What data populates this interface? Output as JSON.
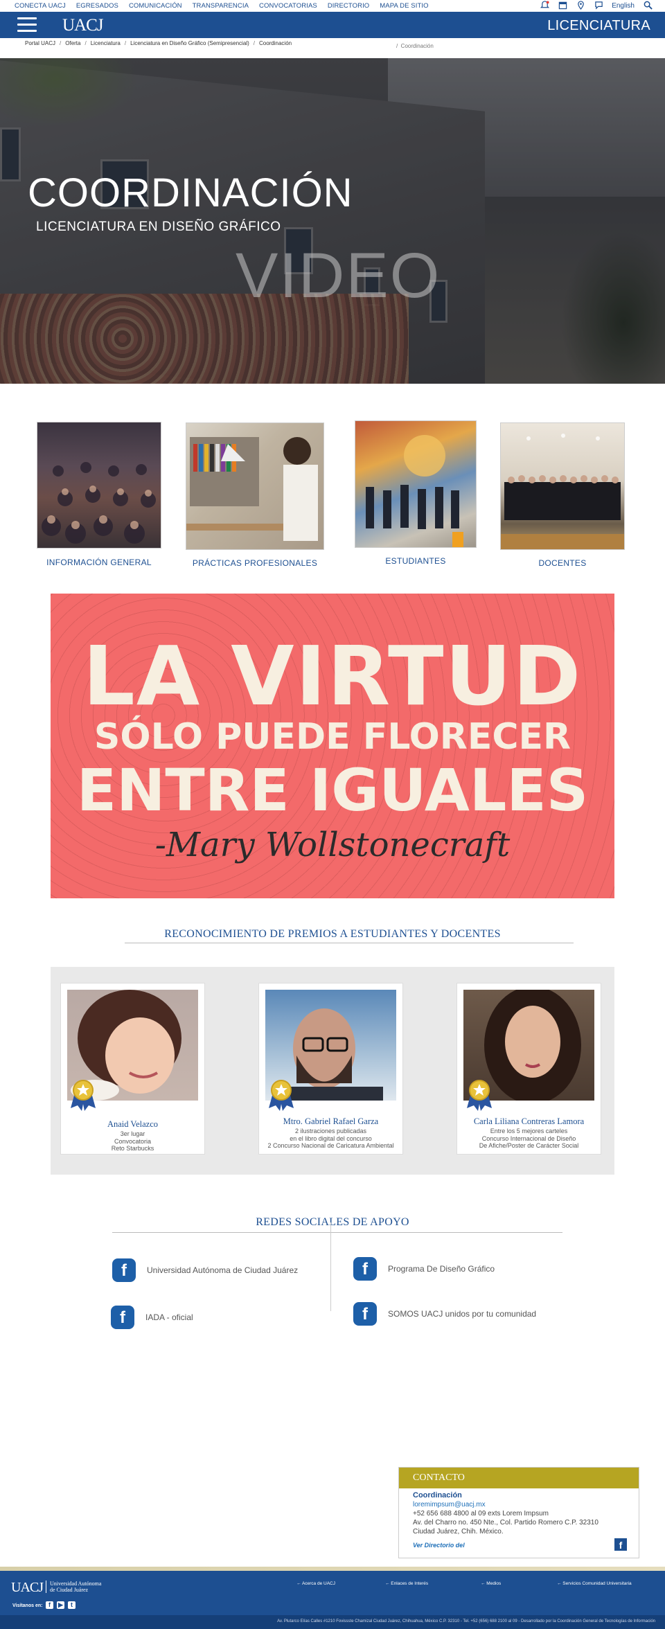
{
  "topbar": {
    "links": [
      "CONECTA UACJ",
      "EGRESADOS",
      "COMUNICACIÓN",
      "TRANSPARENCIA",
      "CONVOCATORIAS",
      "DIRECTORIO",
      "MAPA DE SITIO"
    ],
    "language": "English",
    "icons": [
      "notification-bell-icon",
      "calendar-icon",
      "map-pin-icon",
      "chat-icon",
      "search-icon"
    ]
  },
  "navbar": {
    "logo": "UACJ",
    "title": "LICENCIATURA"
  },
  "breadcrumb": {
    "items": [
      "Portal UACJ",
      "Oferta",
      "Licenciatura",
      "Licenciatura en Diseño Gráfico (Semipresencial)",
      "Coordinación"
    ],
    "right": "Coordinación"
  },
  "hero": {
    "title": "COORDINACIÓN",
    "subtitle": "LICENCIATURA EN DISEÑO GRÁFICO",
    "watermark": "VIDEO"
  },
  "tiles": [
    {
      "label": "INFORMACIÓN GENERAL"
    },
    {
      "label": "PRÁCTICAS PROFESIONALES"
    },
    {
      "label": "ESTUDIANTES"
    },
    {
      "label": "DOCENTES"
    }
  ],
  "banner": {
    "line1": "LA VIRTUD",
    "line2": "SÓLO PUEDE FLORECER",
    "line3": "ENTRE IGUALES",
    "signature": "-Mary Wollstonecraft",
    "color": "#f36a6a"
  },
  "awards": {
    "title": "RECONOCIMIENTO DE PREMIOS A ESTUDIANTES Y DOCENTES",
    "items": [
      {
        "name": "Anaid Velazco",
        "lines": [
          "3er lugar",
          "Convocatoria",
          "Reto Starbucks"
        ]
      },
      {
        "name": "Mtro. Gabriel Rafael Garza",
        "lines": [
          "2 ilustraciones publicadas",
          "en el libro digital del concurso",
          "2 Concurso Nacional de Caricatura Ambiental"
        ]
      },
      {
        "name": "Carla Liliana Contreras Lamora",
        "lines": [
          "Entre los 5 mejores carteles",
          "Concurso Internacional de Diseño",
          "De Afiche/Poster de Carácter Social"
        ]
      }
    ]
  },
  "social": {
    "title": "REDES SOCIALES DE APOYO",
    "items": [
      {
        "label": "Universidad Autónoma de Ciudad Juárez"
      },
      {
        "label": "Programa De Diseño Gráfico"
      },
      {
        "label": "IADA - oficial"
      },
      {
        "label": "SOMOS UACJ unidos por tu comunidad"
      }
    ]
  },
  "contact": {
    "header": "CONTACTO",
    "title": "Coordinación",
    "email": "loremimpsum@uacj.mx",
    "phone": "+52 656 688 4800 al 09 exts Lorem Impsum",
    "address1": "Av. del Charro no. 450 Nte., Col. Partido Romero C.P. 32310",
    "address2": "Ciudad Juárez, Chih. México.",
    "more": "Ver Directorio del"
  },
  "footer": {
    "logo": "UACJ",
    "logo_text1": "Universidad Autónoma",
    "logo_text2": "de Ciudad Juárez",
    "visit": "Visítanos en:",
    "links": [
      "← Acerca de UACJ",
      "← Enlaces de Interés",
      "← Medios",
      "← Servicios Comunidad Universitaria"
    ],
    "address": "Av. Plutarco Elías Calles #1210 Fovissste Chamizal Ciudad Juárez, Chihuahua, México C.P. 32310 - Tel. +52 (656) 688 2100 al 09 - Desarrollado por la Coordinación General de Tecnologías de Información"
  },
  "colors": {
    "brand_blue": "#1d4f91",
    "contact_gold": "#b6a522"
  }
}
